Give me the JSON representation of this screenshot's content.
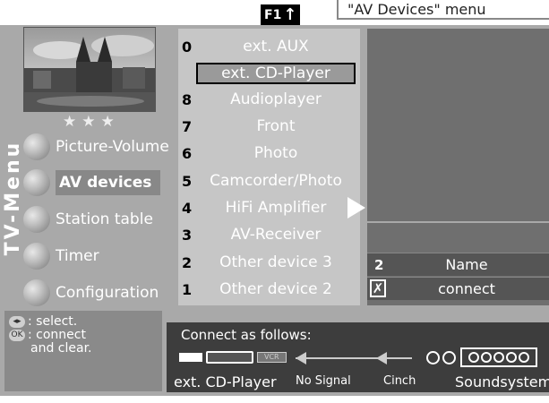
{
  "header": {
    "tab_label": "\"AV Devices\" menu",
    "f1_key": "F1"
  },
  "sidebar": {
    "vertical_label": "TV-Menu",
    "stars": [
      "★",
      "★",
      "★"
    ],
    "items": [
      {
        "label": "Picture-Volume",
        "active": false
      },
      {
        "label": "AV devices",
        "active": true
      },
      {
        "label": "Station table",
        "active": false
      },
      {
        "label": "Timer",
        "active": false
      },
      {
        "label": "Configuration",
        "active": false
      }
    ]
  },
  "sources": [
    {
      "num": "0",
      "label": "ext. AUX"
    },
    {
      "num": "",
      "label": "ext. CD-Player",
      "selected": true
    },
    {
      "num": "8",
      "label": "Audioplayer"
    },
    {
      "num": "7",
      "label": "Front"
    },
    {
      "num": "6",
      "label": "Photo"
    },
    {
      "num": "5",
      "label": "Camcorder/Photo"
    },
    {
      "num": "4",
      "label": "HiFi Amplifier"
    },
    {
      "num": "3",
      "label": "AV-Receiver"
    },
    {
      "num": "2",
      "label": "Other device 3"
    },
    {
      "num": "1",
      "label": "Other device 2"
    }
  ],
  "detail": {
    "rows": [
      {
        "num": "2",
        "label": "Name"
      },
      {
        "check": "✗",
        "label": "connect"
      }
    ]
  },
  "help": {
    "select_key": "◂▸",
    "select_text": ": select.",
    "ok_key": "OK",
    "ok_text": ": connect",
    "ok_text2": "and clear."
  },
  "connection": {
    "title": "Connect as follows:",
    "device_name": "ext. CD-Player",
    "signal": "No Signal",
    "cable": "Cinch",
    "target": "Soundsystem",
    "vcr_tag": "VCR"
  },
  "colors": {
    "frame": "#a9a9a9",
    "panel_light": "#c6c6c6",
    "panel_dark": "#6f6f6f",
    "connect_bar": "#3d3d3d"
  }
}
